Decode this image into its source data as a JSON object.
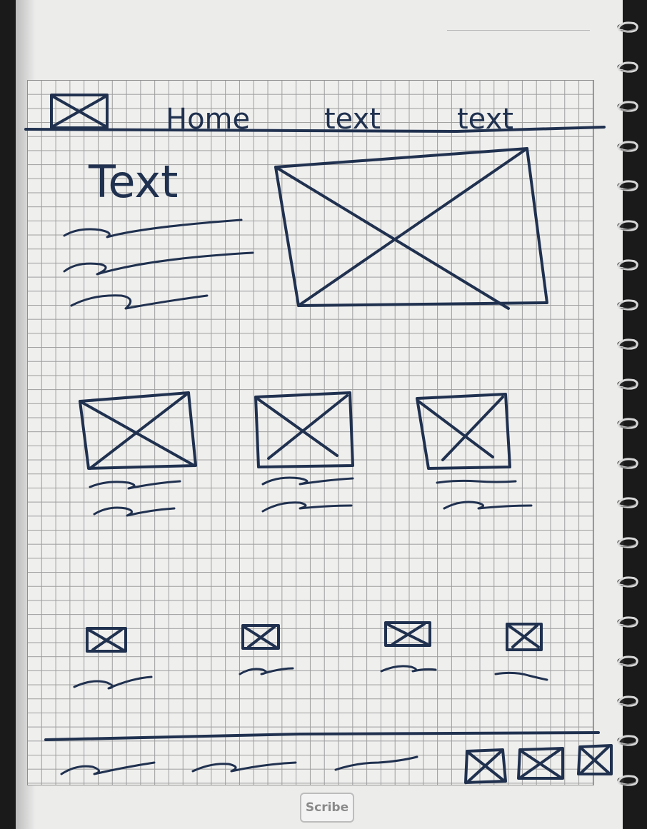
{
  "nav": {
    "items": [
      "Home",
      "text",
      "text"
    ]
  },
  "hero": {
    "heading": "Text"
  },
  "brand": {
    "label": "Scribe"
  },
  "colors": {
    "ink": "#20314f",
    "paper": "#ececeb",
    "grid": "#9d9d9d"
  }
}
